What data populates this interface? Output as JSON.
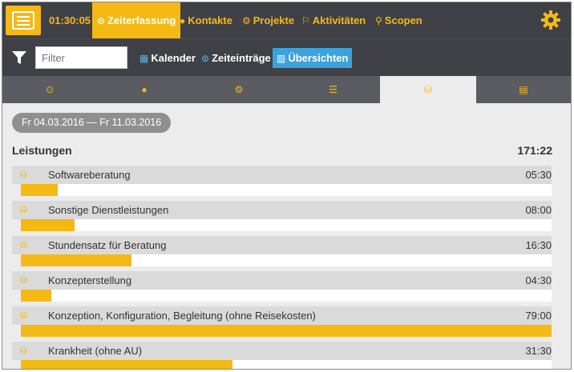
{
  "colors": {
    "accent": "#f5b915",
    "blue": "#3ba3dc",
    "dark": "#3f4146"
  },
  "topnav": {
    "timer": "01:30:05",
    "tabs": [
      {
        "label": "Zeiterfassung",
        "icon": "clock-icon",
        "active": true
      },
      {
        "label": "Kontakte",
        "icon": "person-icon",
        "active": false
      },
      {
        "label": "Projekte",
        "icon": "cogs-icon",
        "active": false
      },
      {
        "label": "Aktivitäten",
        "icon": "flag-icon",
        "active": false
      },
      {
        "label": "Scopen",
        "icon": "search-icon",
        "active": false
      }
    ]
  },
  "subnav": {
    "filter_placeholder": "Filter",
    "tabs": [
      {
        "label": "Kalender",
        "icon": "calendar-icon",
        "active": false
      },
      {
        "label": "Zeiteinträge",
        "icon": "clock-icon",
        "active": false
      },
      {
        "label": "Übersichten",
        "icon": "bar-chart-icon",
        "active": true
      }
    ]
  },
  "icontabs": [
    {
      "icon": "clock-icon",
      "active": false
    },
    {
      "icon": "person-icon",
      "active": false
    },
    {
      "icon": "cogs-icon",
      "active": false
    },
    {
      "icon": "list-icon",
      "active": false
    },
    {
      "icon": "coins-icon",
      "active": true
    },
    {
      "icon": "card-icon",
      "active": false
    }
  ],
  "content": {
    "daterange": "Fr 04.03.2016 — Fr 11.03.2016",
    "section_title": "Leistungen",
    "section_total": "171:22",
    "rows": [
      {
        "label": "Softwareberatung",
        "value": "05:30",
        "fraction": 0.07
      },
      {
        "label": "Sonstige Dienstleistungen",
        "value": "08:00",
        "fraction": 0.101
      },
      {
        "label": "Stundensatz für Beratung",
        "value": "16:30",
        "fraction": 0.209
      },
      {
        "label": "Konzepterstellung",
        "value": "04:30",
        "fraction": 0.057
      },
      {
        "label": "Konzeption, Konfiguration, Begleitung (ohne Reisekosten)",
        "value": "79:00",
        "fraction": 1.0
      },
      {
        "label": "Krankheit (ohne AU)",
        "value": "31:30",
        "fraction": 0.399
      }
    ]
  }
}
